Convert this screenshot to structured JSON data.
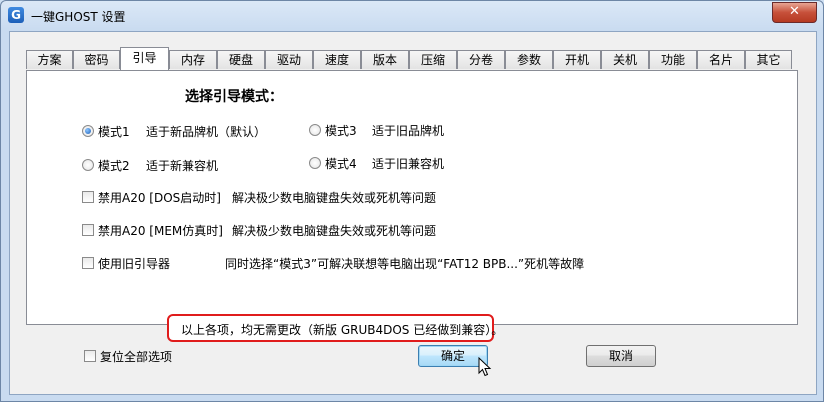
{
  "window": {
    "title": "一键GHOST 设置",
    "icon_letter": "G",
    "close_glyph": "✕"
  },
  "tabs": [
    {
      "label": "方案"
    },
    {
      "label": "密码"
    },
    {
      "label": "引导"
    },
    {
      "label": "内存"
    },
    {
      "label": "硬盘"
    },
    {
      "label": "驱动"
    },
    {
      "label": "速度"
    },
    {
      "label": "版本"
    },
    {
      "label": "压缩"
    },
    {
      "label": "分卷"
    },
    {
      "label": "参数"
    },
    {
      "label": "开机"
    },
    {
      "label": "关机"
    },
    {
      "label": "功能"
    },
    {
      "label": "名片"
    },
    {
      "label": "其它"
    }
  ],
  "active_tab": "引导",
  "boot": {
    "heading": "选择引导模式：",
    "modes": [
      {
        "name": "模式1",
        "desc": "适于新品牌机（默认）",
        "selected": true
      },
      {
        "name": "模式3",
        "desc": "适于旧品牌机",
        "selected": false
      },
      {
        "name": "模式2",
        "desc": "适于新兼容机",
        "selected": false
      },
      {
        "name": "模式4",
        "desc": "适于旧兼容机",
        "selected": false
      }
    ],
    "options": [
      {
        "label": "禁用A20 [DOS启动时]",
        "desc": "解决极少数电脑键盘失效或死机等问题",
        "checked": false
      },
      {
        "label": "禁用A20 [MEM仿真时]",
        "desc": "解决极少数电脑键盘失效或死机等问题",
        "checked": false
      },
      {
        "label": "使用旧引导器",
        "desc": "同时选择“模式3”可解决联想等电脑出现“FAT12 BPB...”死机等故障",
        "checked": false
      }
    ],
    "note": "以上各项，均无需更改（新版 GRUB4DOS 已经做到兼容）。"
  },
  "footer": {
    "reset_label": "复位全部选项",
    "reset_checked": false,
    "ok_label": "确定",
    "cancel_label": "取消"
  },
  "colors": {
    "highlight_border": "#e01c1c",
    "accent": "#1c5fb8"
  }
}
